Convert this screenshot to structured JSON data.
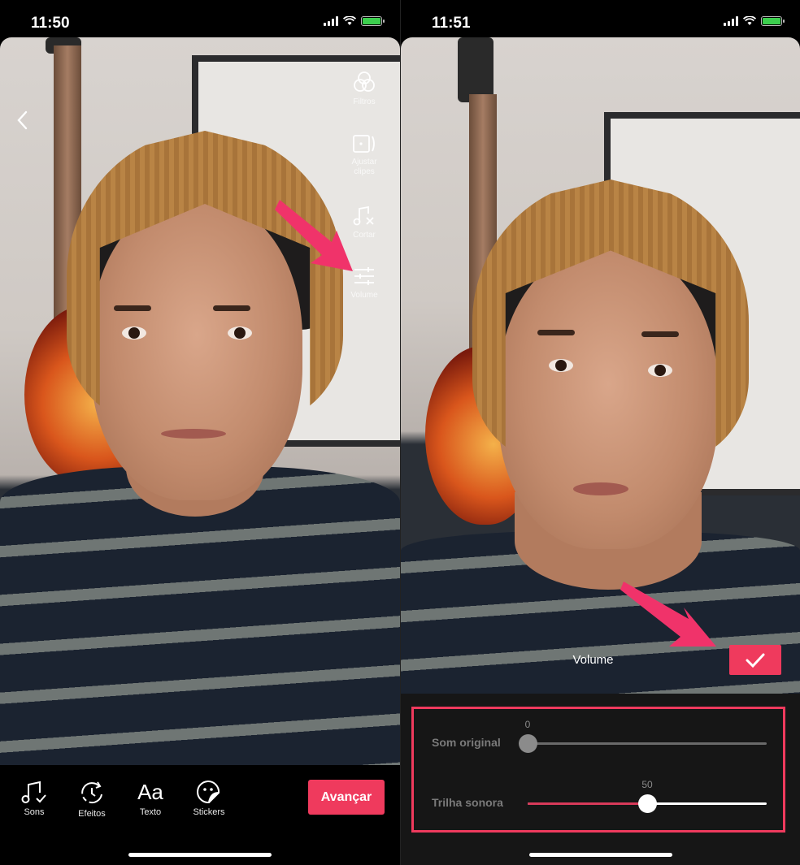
{
  "left_screen": {
    "status": {
      "time": "11:50"
    },
    "side_tools": [
      {
        "icon": "filters-icon",
        "label": "Filtros"
      },
      {
        "icon": "adjust-clips-icon",
        "label": "Ajustar clipes"
      },
      {
        "icon": "cut-music-icon",
        "label": "Cortar"
      },
      {
        "icon": "volume-sliders-icon",
        "label": "Volume"
      }
    ],
    "bottom_tools": [
      {
        "icon": "music-check-icon",
        "label": "Sons"
      },
      {
        "icon": "effects-timer-icon",
        "label": "Efeitos"
      },
      {
        "icon": "text-aa-icon",
        "label": "Texto"
      },
      {
        "icon": "sticker-icon",
        "label": "Stickers"
      }
    ],
    "text_glyph": "Aa",
    "next_button": "Avançar",
    "accent_color": "#ef3a5d"
  },
  "right_screen": {
    "status": {
      "time": "11:51"
    },
    "volume_title": "Volume",
    "sliders": [
      {
        "label": "Som original",
        "value": 0,
        "value_text": "0",
        "max": 100
      },
      {
        "label": "Trilha sonora",
        "value": 50,
        "value_text": "50",
        "max": 100
      }
    ],
    "accent_color": "#ef3a5d"
  }
}
